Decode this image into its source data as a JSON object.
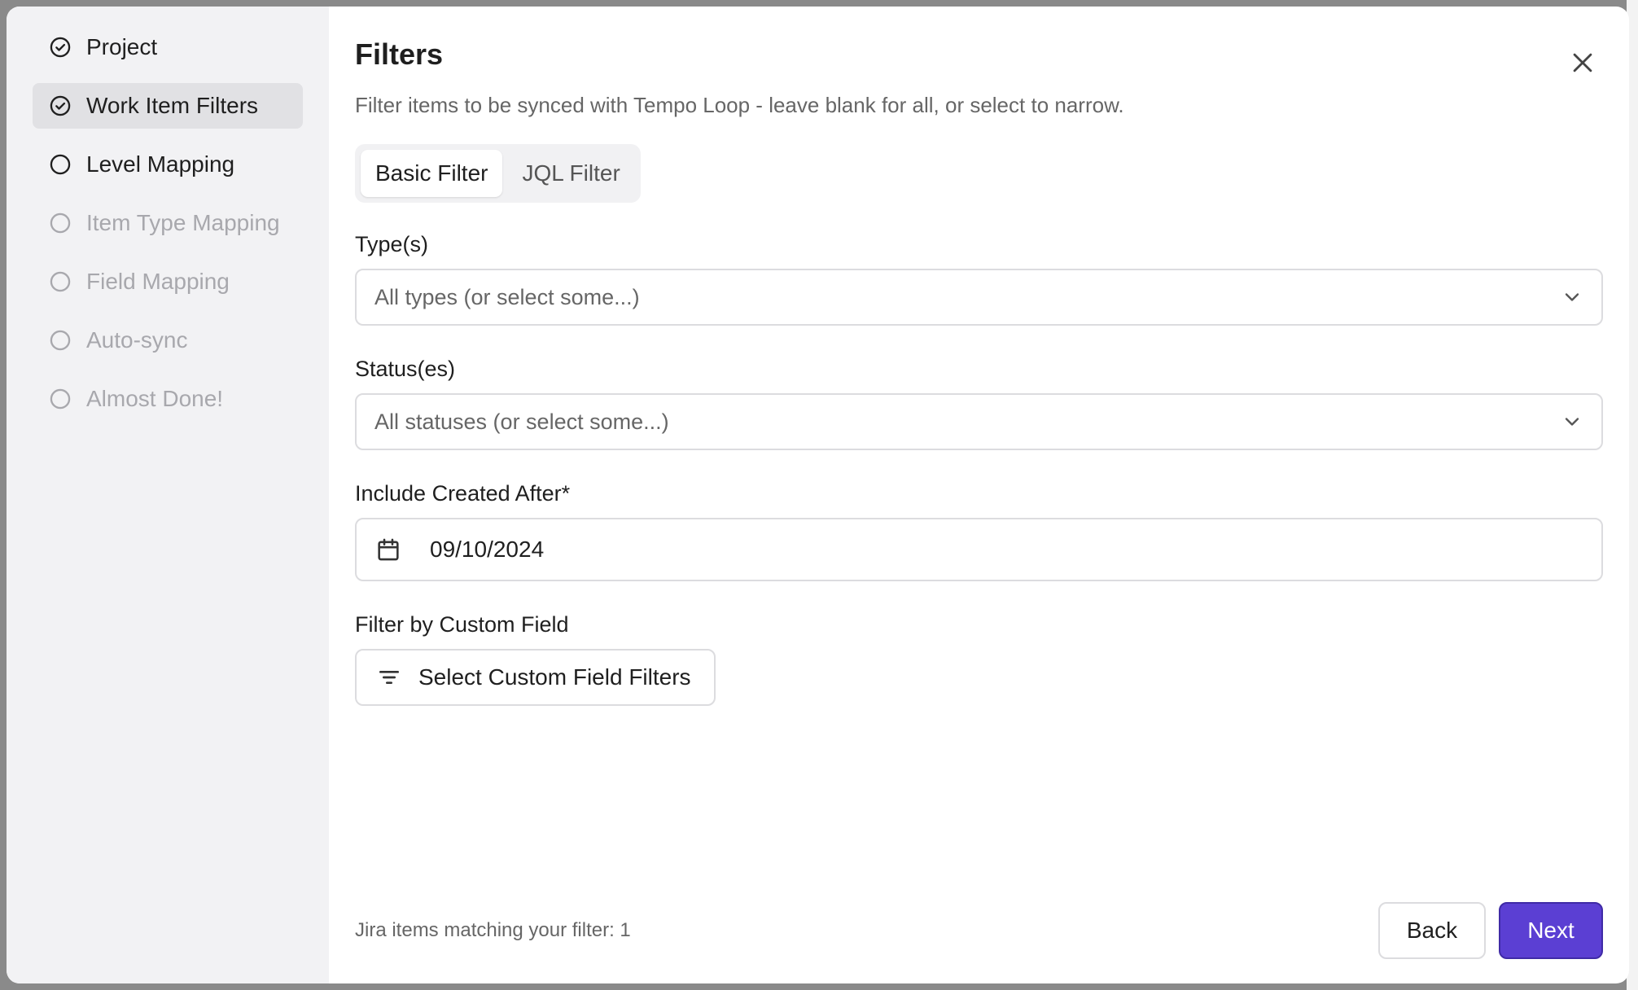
{
  "sidebar": {
    "steps": [
      {
        "label": "Project",
        "state": "complete"
      },
      {
        "label": "Work Item Filters",
        "state": "active"
      },
      {
        "label": "Level Mapping",
        "state": "pending"
      },
      {
        "label": "Item Type Mapping",
        "state": "disabled"
      },
      {
        "label": "Field Mapping",
        "state": "disabled"
      },
      {
        "label": "Auto-sync",
        "state": "disabled"
      },
      {
        "label": "Almost Done!",
        "state": "disabled"
      }
    ]
  },
  "header": {
    "title": "Filters",
    "subtitle": "Filter items to be synced with Tempo Loop - leave blank for all, or select to narrow.",
    "close_icon": "close-icon"
  },
  "tabs": [
    {
      "label": "Basic Filter",
      "active": true
    },
    {
      "label": "JQL Filter",
      "active": false
    }
  ],
  "fields": {
    "types": {
      "label": "Type(s)",
      "placeholder": "All types (or select some...)"
    },
    "statuses": {
      "label": "Status(es)",
      "placeholder": "All statuses (or select some...)"
    },
    "created_after": {
      "label": "Include Created After*",
      "value": "09/10/2024"
    },
    "custom_field": {
      "label": "Filter by Custom Field",
      "button_label": "Select Custom Field Filters"
    }
  },
  "footer": {
    "match_text": "Jira items matching your filter: 1",
    "back_label": "Back",
    "next_label": "Next"
  },
  "colors": {
    "accent": "#5b3fd3",
    "sidebar_bg": "#f2f2f4",
    "active_step_bg": "#e1e1e4"
  }
}
